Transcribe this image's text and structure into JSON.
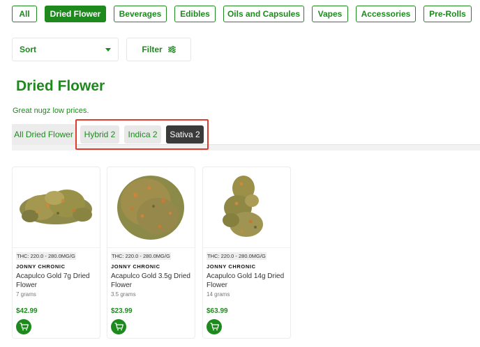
{
  "categories": [
    {
      "label": "All",
      "active": false
    },
    {
      "label": "Dried Flower",
      "active": true
    },
    {
      "label": "Beverages",
      "active": false
    },
    {
      "label": "Edibles",
      "active": false
    },
    {
      "label": "Oils and Capsules",
      "active": false
    },
    {
      "label": "Vapes",
      "active": false
    },
    {
      "label": "Accessories",
      "active": false
    },
    {
      "label": "Pre-Rolls",
      "active": false
    }
  ],
  "controls": {
    "sort_label": "Sort",
    "filter_label": "Filter"
  },
  "page": {
    "title": "Dried Flower",
    "subtitle": "Great nugz low prices."
  },
  "strain_tabs": [
    {
      "label": "All Dried Flower",
      "selected": false
    },
    {
      "label": "Hybrid 2",
      "selected": false
    },
    {
      "label": "Indica 2",
      "selected": false
    },
    {
      "label": "Sativa 2",
      "selected": true
    }
  ],
  "products": [
    {
      "thc": "THC: 220.0 - 280.0MG/G",
      "brand": "JONNY CHRONIC",
      "name": "Acapulco Gold 7g Dried Flower",
      "weight": "7 grams",
      "price": "$42.99",
      "image": "cannabis-bud-image"
    },
    {
      "thc": "THC: 220.0 - 280.0MG/G",
      "brand": "JONNY CHRONIC",
      "name": "Acapulco Gold 3.5g Dried Flower",
      "weight": "3.5 grams",
      "price": "$23.99",
      "image": "cannabis-bud-image"
    },
    {
      "thc": "THC: 220.0 - 280.0MG/G",
      "brand": "JONNY CHRONIC",
      "name": "Acapulco Gold 14g Dried Flower",
      "weight": "14 grams",
      "price": "$63.99",
      "image": "cannabis-bud-image"
    }
  ],
  "colors": {
    "accent": "#1e8a1e",
    "highlight": "#e23b2e",
    "selected_tab": "#3a3a3a"
  }
}
